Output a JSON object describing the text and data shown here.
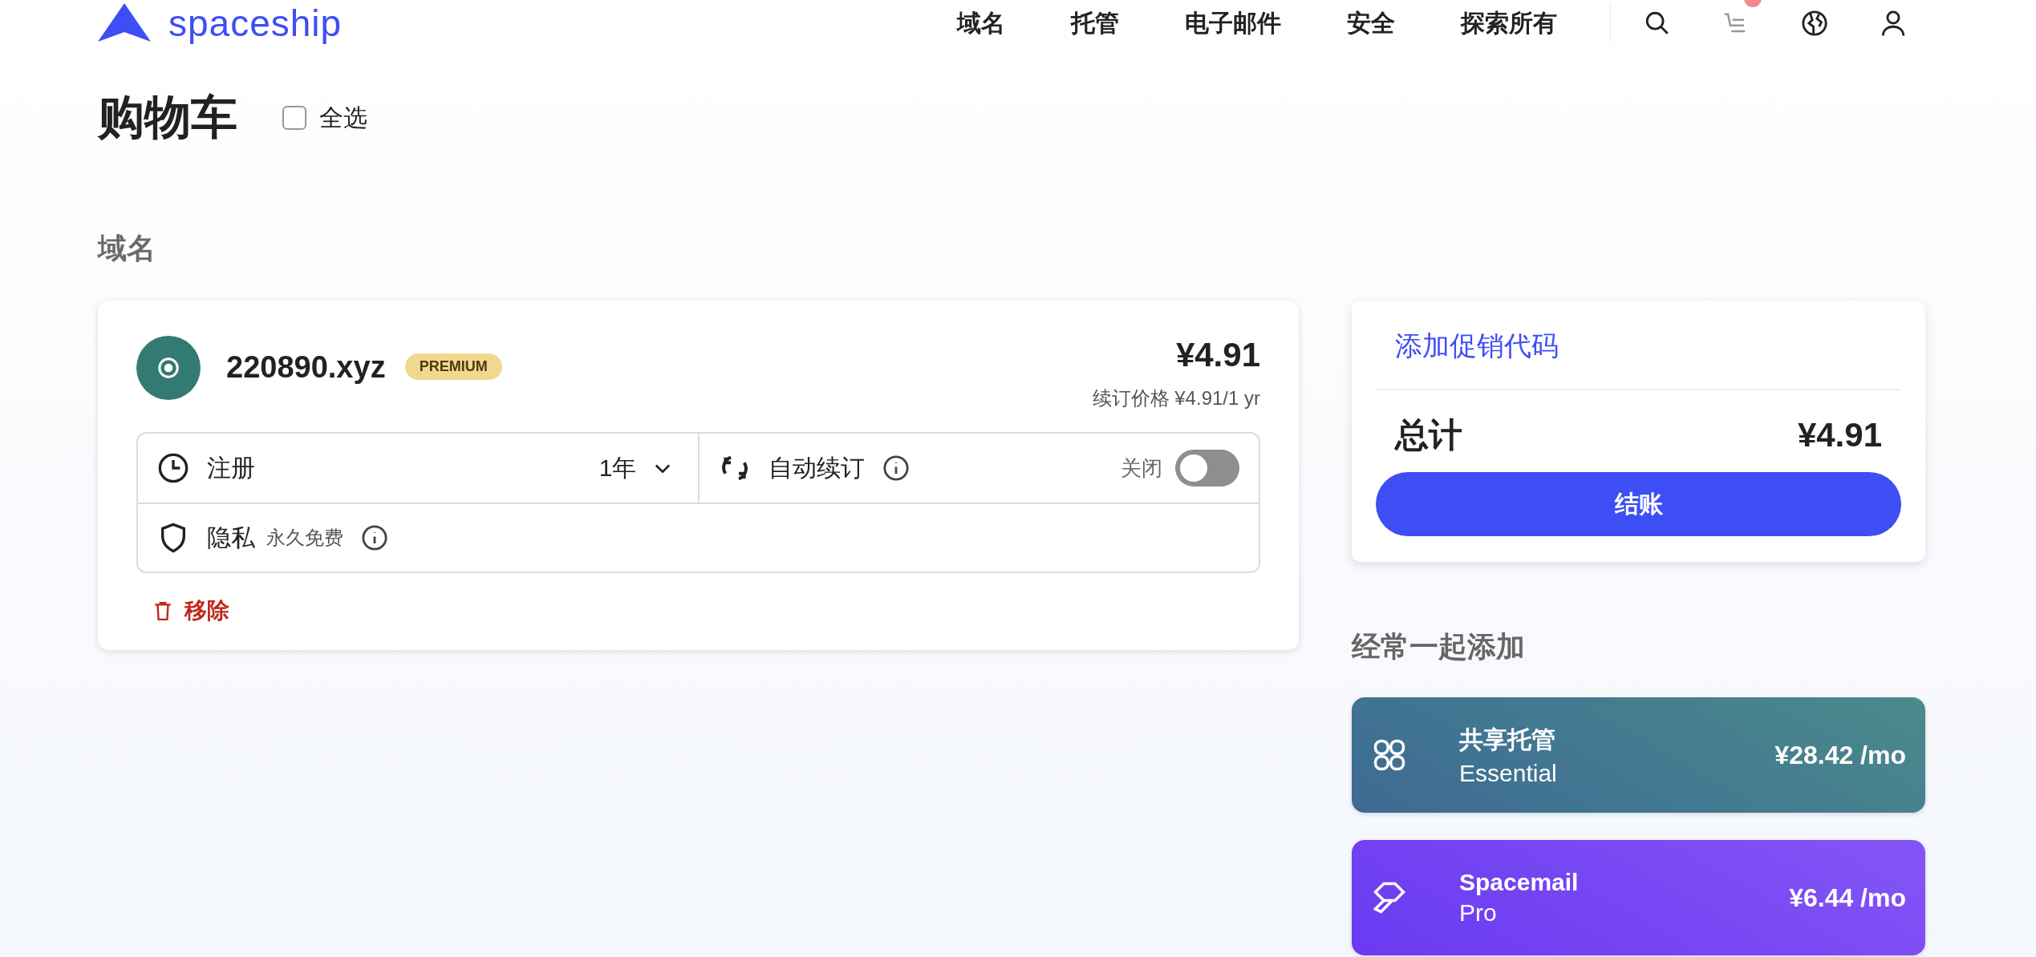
{
  "header": {
    "logo": "spaceship",
    "nav": [
      "域名",
      "托管",
      "电子邮件",
      "安全",
      "探索所有"
    ],
    "cart_badge": true
  },
  "page": {
    "title": "购物车",
    "select_all": {
      "label": "全选",
      "checked": false
    }
  },
  "section": {
    "title": "域名"
  },
  "cart_item": {
    "domain": "220890.xyz",
    "badge": "PREMIUM",
    "price": "¥4.91",
    "renewal": "续订价格 ¥4.91/1 yr",
    "registration": {
      "label": "注册",
      "value": "1年"
    },
    "auto_renew": {
      "label": "自动续订",
      "state_label": "关闭",
      "on": false
    },
    "privacy": {
      "label": "隐私",
      "note": "永久免费"
    },
    "remove": "移除"
  },
  "summary": {
    "promo": "添加促销代码",
    "total_label": "总计",
    "total": "¥4.91",
    "checkout": "结账"
  },
  "suggestions": {
    "title": "经常一起添加",
    "items": [
      {
        "kind": "hosting",
        "name": "共享托管",
        "plan": "Essential",
        "price": "¥28.42 /mo"
      },
      {
        "kind": "email",
        "name": "Spacemail",
        "plan": "Pro",
        "price": "¥6.44 /mo"
      }
    ]
  }
}
